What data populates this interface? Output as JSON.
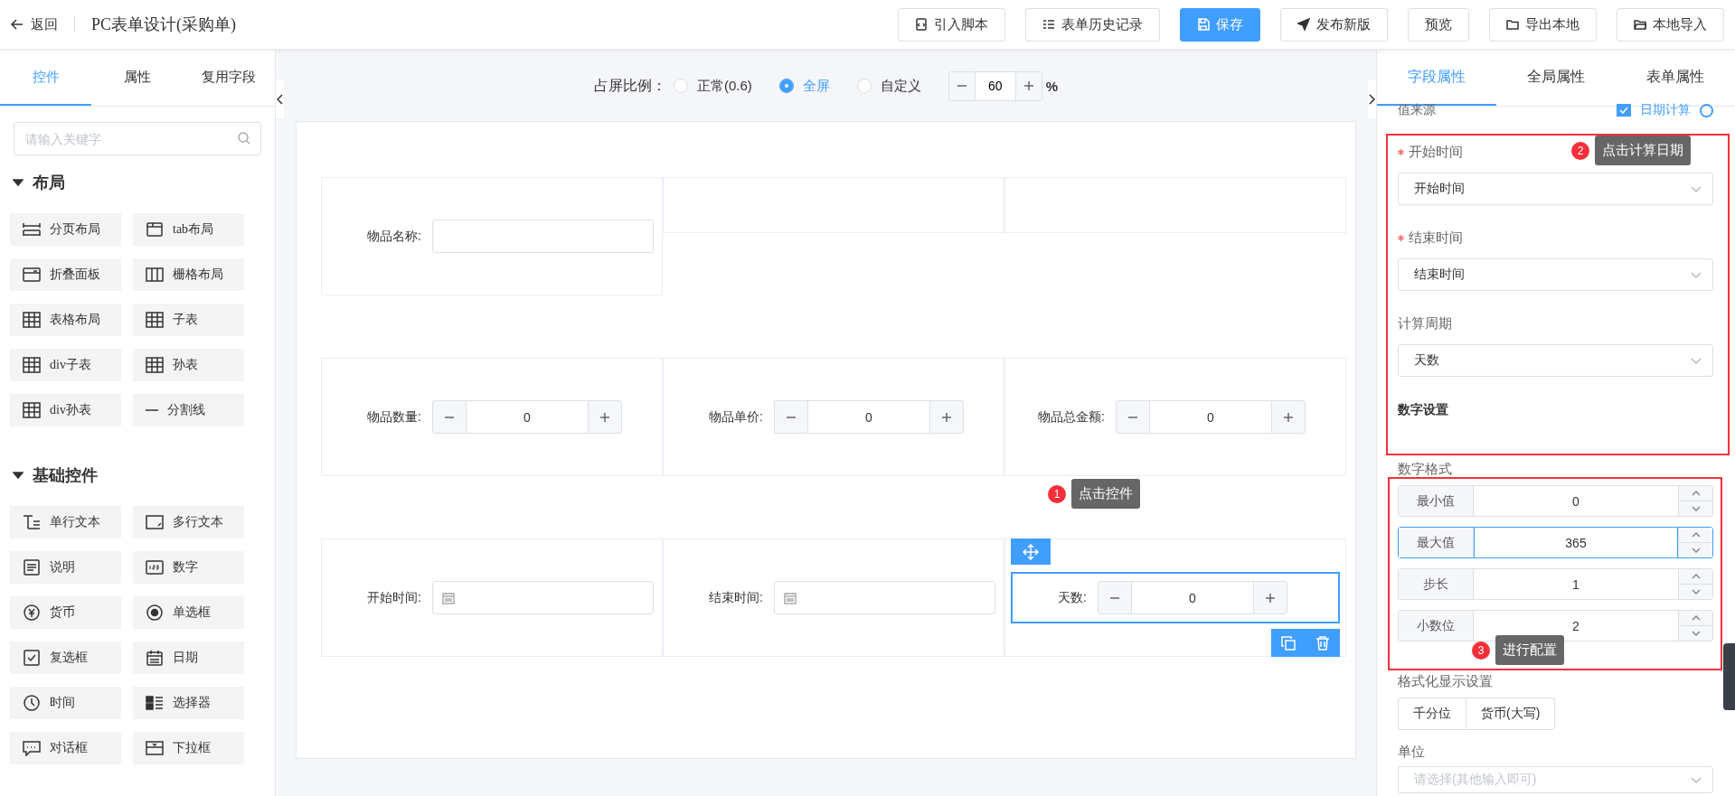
{
  "header": {
    "back": "返回",
    "title": "PC表单设计(采购单)",
    "buttons": [
      {
        "label": "引入脚本",
        "primary": false
      },
      {
        "label": "表单历史记录",
        "primary": false
      },
      {
        "label": "保存",
        "primary": true
      },
      {
        "label": "发布新版",
        "primary": false
      },
      {
        "label": "预览",
        "primary": false
      },
      {
        "label": "导出本地",
        "primary": false
      },
      {
        "label": "本地导入",
        "primary": false
      }
    ]
  },
  "left_panel": {
    "tabs": [
      {
        "label": "控件",
        "selected": true
      },
      {
        "label": "属性",
        "selected": false
      },
      {
        "label": "复用字段",
        "selected": false
      }
    ],
    "search": {
      "placeholder": "请输入关键字"
    },
    "groups": [
      {
        "title": "布局",
        "expanded": true,
        "items": [
          "分页布局",
          "tab布局",
          "折叠面板",
          "栅格布局",
          "表格布局",
          "子表",
          "div子表",
          "孙表",
          "div孙表",
          "分割线"
        ]
      },
      {
        "title": "基础控件",
        "expanded": true,
        "items": [
          "单行文本",
          "多行文本",
          "说明",
          "数字",
          "货币",
          "单选框",
          "复选框",
          "日期",
          "时间",
          "选择器",
          "对话框",
          "下拉框"
        ]
      }
    ]
  },
  "canvas": {
    "scale": {
      "label": "占屏比例：",
      "options": [
        {
          "label": "正常(0.6)",
          "selected": false
        },
        {
          "label": "全屏",
          "selected": true
        },
        {
          "label": "自定义",
          "selected": false
        }
      ],
      "value": "60",
      "unit": "%"
    },
    "rows": [
      {
        "cells": [
          {
            "kind": "text",
            "label": "物品名称:",
            "selected": false
          },
          {
            "kind": "empty",
            "selected": false
          },
          {
            "kind": "empty",
            "selected": false
          }
        ]
      },
      {
        "cells": [
          {
            "kind": "number",
            "label": "物品数量:",
            "value": "0",
            "selected": false
          },
          {
            "kind": "number",
            "label": "物品单价:",
            "value": "0",
            "selected": false
          },
          {
            "kind": "number",
            "label": "物品总金额:",
            "value": "0",
            "selected": false
          }
        ]
      },
      {
        "cells": [
          {
            "kind": "date",
            "label": "开始时间:",
            "selected": false
          },
          {
            "kind": "date",
            "label": "结束时间:",
            "selected": false
          },
          {
            "kind": "number",
            "label": "天数:",
            "value": "0",
            "selected": true
          }
        ]
      }
    ]
  },
  "right_panel": {
    "tabs": [
      {
        "label": "字段属性",
        "selected": true
      },
      {
        "label": "全局属性",
        "selected": false
      },
      {
        "label": "表单属性",
        "selected": false
      }
    ],
    "value_source": {
      "label": "值来源",
      "option": "日期计算",
      "checked": true
    },
    "fields": [
      {
        "label": "开始时间",
        "required": true,
        "value": "开始时间"
      },
      {
        "label": "结束时间",
        "required": true,
        "value": "结束时间"
      },
      {
        "label": "计算周期",
        "required": false,
        "value": "天数"
      }
    ],
    "section_title": "数字设置",
    "format_label": "数字格式",
    "number_inputs": [
      {
        "label": "最小值",
        "value": "0",
        "focused": false
      },
      {
        "label": "最大值",
        "value": "365",
        "focused": true
      },
      {
        "label": "步长",
        "value": "1",
        "focused": false
      },
      {
        "label": "小数位",
        "value": "2",
        "focused": false
      }
    ],
    "display_label": "格式化显示设置",
    "display_buttons": [
      "千分位",
      "货币(大写)"
    ],
    "unit": {
      "label": "单位",
      "placeholder": "请选择(其他输入即可)"
    }
  },
  "annotations": [
    {
      "number": "1",
      "text": "点击控件"
    },
    {
      "number": "2",
      "text": "点击计算日期"
    },
    {
      "number": "3",
      "text": "进行配置"
    }
  ]
}
